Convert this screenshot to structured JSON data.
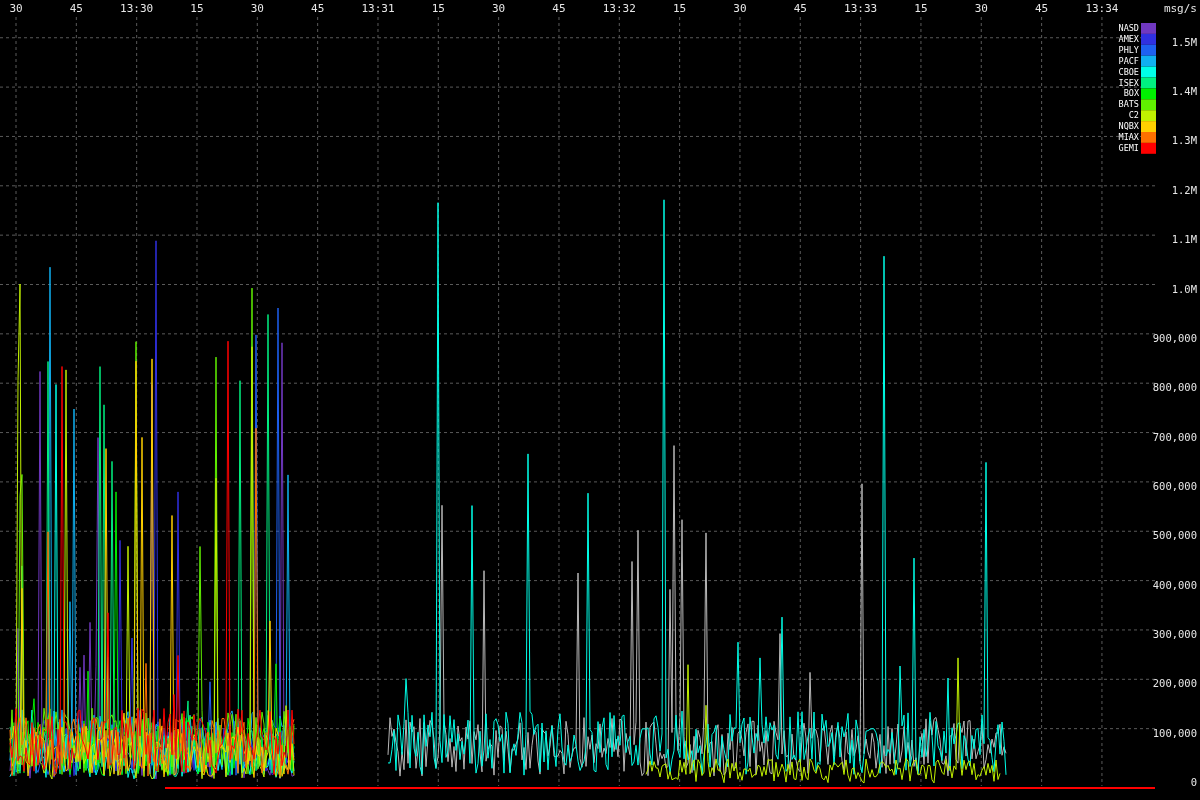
{
  "x_axis": {
    "labels": [
      "30",
      "45",
      "13:30",
      "15",
      "30",
      "45",
      "13:31",
      "15",
      "30",
      "45",
      "13:32",
      "15",
      "30",
      "45",
      "13:33",
      "15",
      "30",
      "45",
      "13:34"
    ]
  },
  "y_axis": {
    "unit": "msg/s",
    "labels": [
      "1.5M",
      "1.4M",
      "1.3M",
      "1.2M",
      "1.1M",
      "1.0M",
      "900,000",
      "800,000",
      "700,000",
      "600,000",
      "500,000",
      "400,000",
      "300,000",
      "200,000",
      "100,000",
      "0"
    ]
  },
  "legend": [
    {
      "label": "NASD",
      "color": "#7038c0"
    },
    {
      "label": "AMEX",
      "color": "#3030e0"
    },
    {
      "label": "PHLY",
      "color": "#1e60f0"
    },
    {
      "label": "PACF",
      "color": "#10b0f0"
    },
    {
      "label": "CBOE",
      "color": "#00ffe8"
    },
    {
      "label": "ISEX",
      "color": "#00f080"
    },
    {
      "label": "BOX",
      "color": "#00f000"
    },
    {
      "label": "BATS",
      "color": "#60f000"
    },
    {
      "label": "C2",
      "color": "#c0f000"
    },
    {
      "label": "NQBX",
      "color": "#ffd000"
    },
    {
      "label": "MIAX",
      "color": "#ff7000"
    },
    {
      "label": "GEMI",
      "color": "#ff0000"
    }
  ]
}
